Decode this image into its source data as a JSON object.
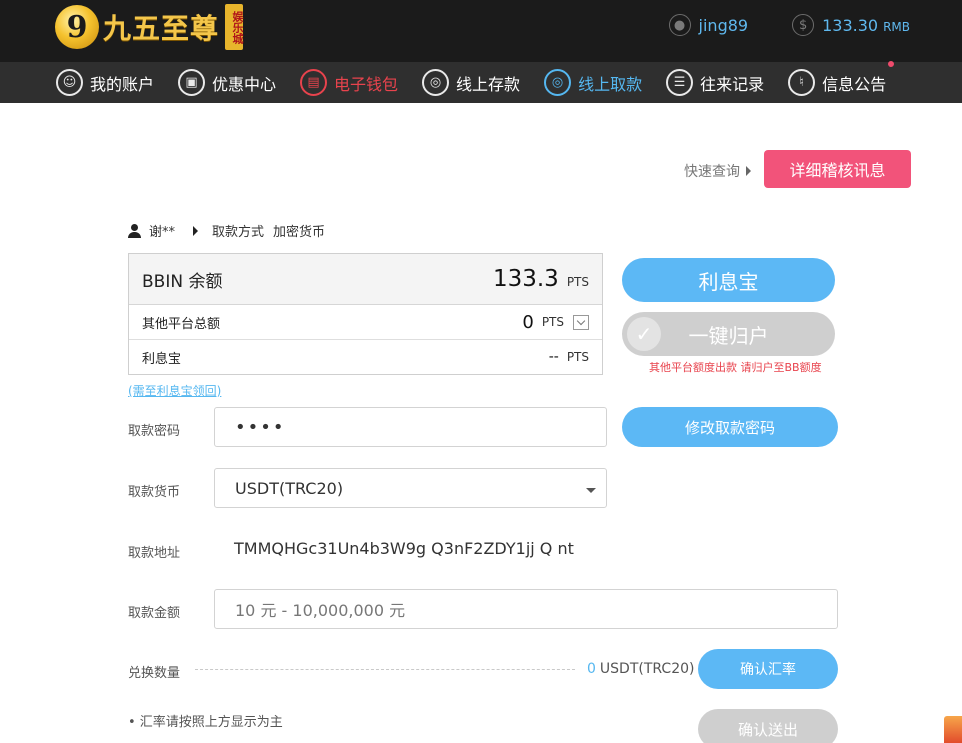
{
  "header": {
    "logo_text": "九五至尊",
    "logo_sub": "娱乐城",
    "username": "jing89",
    "balance": "133.30",
    "currency": "RMB"
  },
  "nav": {
    "items": [
      {
        "label": "我的账户",
        "icon": "user-icon"
      },
      {
        "label": "优惠中心",
        "icon": "gift-icon"
      },
      {
        "label": "电子钱包",
        "icon": "wallet-icon",
        "color": "#e8434d"
      },
      {
        "label": "线上存款",
        "icon": "deposit-icon"
      },
      {
        "label": "线上取款",
        "icon": "withdraw-icon",
        "color": "#55b7f0"
      },
      {
        "label": "往来记录",
        "icon": "record-icon"
      },
      {
        "label": "信息公告",
        "icon": "bell-icon"
      }
    ]
  },
  "quick_query": "快速查询",
  "detail_button": "详细稽核讯息",
  "breadcrumb": {
    "user": "谢**",
    "method_label": "取款方式",
    "method_value": "加密货币"
  },
  "balances": {
    "bbin_label": "BBIN 余额",
    "bbin_value": "133.3",
    "other_label": "其他平台总额",
    "other_value": "0",
    "liyibao_label": "利息宝",
    "liyibao_value": "--",
    "unit": "PTS",
    "link": "(需至利息宝领回)"
  },
  "buttons": {
    "liyibao": "利息宝",
    "onekey": "一键归户",
    "onekey_note": "其他平台额度出款 请归户至BB额度",
    "change_password": "修改取款密码",
    "confirm_rate": "确认汇率",
    "confirm_send": "确认送出"
  },
  "form": {
    "password_label": "取款密码",
    "password_value": "••••",
    "currency_label": "取款货币",
    "currency_value": "USDT(TRC20)",
    "address_label": "取款地址",
    "address_value": "TMMQHGc31Un4b3W9g  Q3nF2ZDY1jj  Q  nt",
    "amount_label": "取款金额",
    "amount_placeholder": "10 元 - 10,000,000 元",
    "exchange_label": "兑换数量",
    "exchange_value": "0",
    "exchange_unit": "USDT(TRC20)",
    "note": "• 汇率请按照上方显示为主"
  },
  "colors": {
    "accent_blue": "#5cb8f5",
    "accent_pink": "#f2537a",
    "accent_red": "#e8434d",
    "disabled": "#cfcfcf"
  }
}
